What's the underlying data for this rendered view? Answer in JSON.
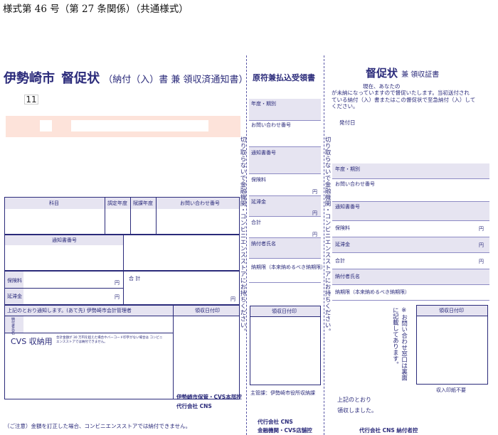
{
  "form_header": "様式第 46 号（第 27 条関係）（共通様式）",
  "left": {
    "city": "伊勢崎市",
    "title": "督促状",
    "subtitle": "（納付（入）書 兼 領収済通知書）",
    "code": "11",
    "headers": {
      "subject": "科目",
      "levy_year": "調定年度",
      "tax_year": "賦課年度",
      "inquiry": "お問い合わせ番号",
      "notice_no": "通知書番号",
      "insurance": "保険料",
      "late_fee": "延滞金",
      "total": "合 計",
      "yen": "円",
      "notice_line": "上記のとおり通知します。(あて先) 伊勢崎市会計管理者",
      "receipt_stamp": "領収日付印",
      "payer": "納付者氏名",
      "cvs_label": "CVS 収納用",
      "cvs_note": "合計金額が 30 万円を超えた場合やバーコード印字がない場合は コンビニエンスストアでは納付できません。",
      "org_line1": "伊勢崎市保管・CVS本部控",
      "org_line2": "代行会社 CNS",
      "caution": "（ご注意）金額を訂正した場合、コンビニエンスストアでは納付できません。"
    }
  },
  "middle": {
    "title": "原符兼払込受領書",
    "year_period": "年度・期別",
    "inquiry": "お問い合わせ番号",
    "notice_no": "通知書番号",
    "insurance": "保険料",
    "late_fee": "延滞金",
    "total": "合計",
    "yen": "円",
    "payer": "納付者氏名",
    "deadline": "納期限（本来納めるべき納期限）",
    "receipt_stamp": "領収日付印",
    "custodian": "主管課：伊勢崎市役所収納課",
    "org_line1": "代行会社 CNS",
    "org_line2": "金融機関・CVS店舗控"
  },
  "separator_text": "切り取らないで金融機関・コンビニエンスストアにお持ちください。",
  "right": {
    "title": "督促状",
    "subtitle": "兼 領収証書",
    "message_line1": "現在、あなたの",
    "message_line2": "が未納になっていますので督促いたします。当初送付され",
    "message_line3": "ている納付（入）書またはこの督促状で至急納付（入）して",
    "message_line4": "ください。",
    "issue_date": "発付日",
    "year_period": "年度・期別",
    "inquiry": "お問い合わせ番号",
    "notice_no": "通知書番号",
    "insurance": "保険料",
    "late_fee": "延滞金",
    "total": "合計",
    "yen": "円",
    "payer": "納付者氏名",
    "deadline": "納期限（本来納めるべき納期限）",
    "inquiry_note": "※お問い合わせ窓口は裏面に記載してあります。",
    "receipt_stamp": "領収日付印",
    "no_stamp": "収入印紙不要",
    "received1": "上記のとおり",
    "received2": "領収しました。",
    "org_line": "代行会社 CNS 納付者控"
  }
}
